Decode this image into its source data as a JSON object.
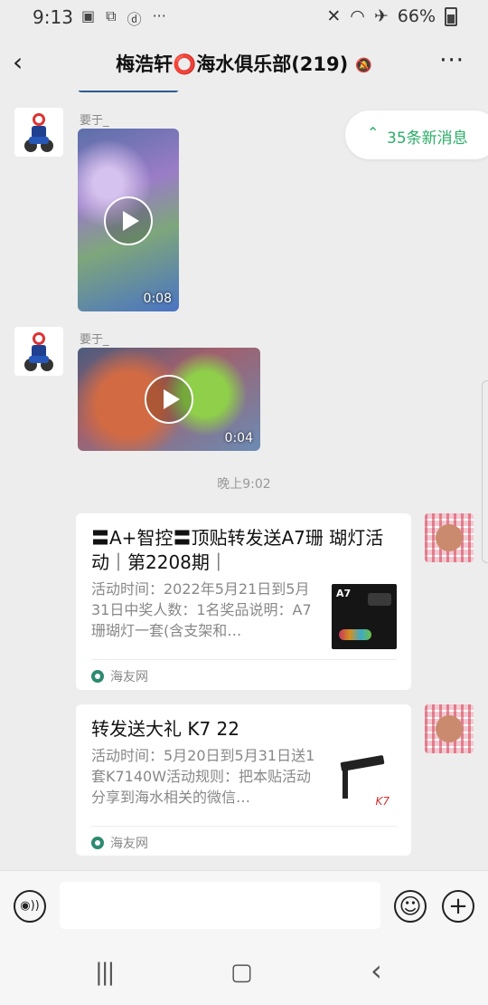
{
  "status_bar": {
    "time": "9:13",
    "left_icons": [
      "image-icon",
      "clipboard-icon",
      "d-app-icon",
      "more-dots-icon"
    ],
    "left_dots": "···",
    "battery_percent": "66%",
    "right_icons": [
      "mute-icon",
      "wifi-icon",
      "airplane-icon",
      "battery-icon"
    ]
  },
  "header": {
    "back_icon": "‹",
    "title": "梅浩轩⭕海水俱乐部(219)",
    "mute_glyph": "🔕",
    "more_icon": "···"
  },
  "new_messages": {
    "label": "35条新消息",
    "arrow": "⌃⌃"
  },
  "messages": [
    {
      "type": "video",
      "sender": "要于_",
      "duration": "0:08"
    },
    {
      "type": "video",
      "sender": "要于_",
      "duration": "0:04"
    }
  ],
  "timestamp": "晚上9:02",
  "cards": [
    {
      "title": "〓A+智控〓顶贴转发送A7珊 瑚灯活动｜第2208期｜",
      "desc": "活动时间：2022年5月21日到5月31日中奖人数：1名奖品说明：A7珊瑚灯一套(含支架和…",
      "thumb_label": "A7",
      "source": "海友网"
    },
    {
      "title": "转发送大礼 K7 22",
      "desc": "活动时间：5月20日到5月31日送1套K7140W活动规则：把本贴活动分享到海水相关的微信…",
      "thumb_label": "K7",
      "source": "海友网"
    }
  ],
  "input_bar": {
    "voice_icon": "◉))",
    "emoji_icon": "☺",
    "plus_icon": "+",
    "placeholder": ""
  },
  "nav_bar": {
    "recents_icon": "|||",
    "home_icon": "▢",
    "back_icon": "‹"
  },
  "colors": {
    "accent_green": "#2aae67",
    "background": "#ededed"
  }
}
